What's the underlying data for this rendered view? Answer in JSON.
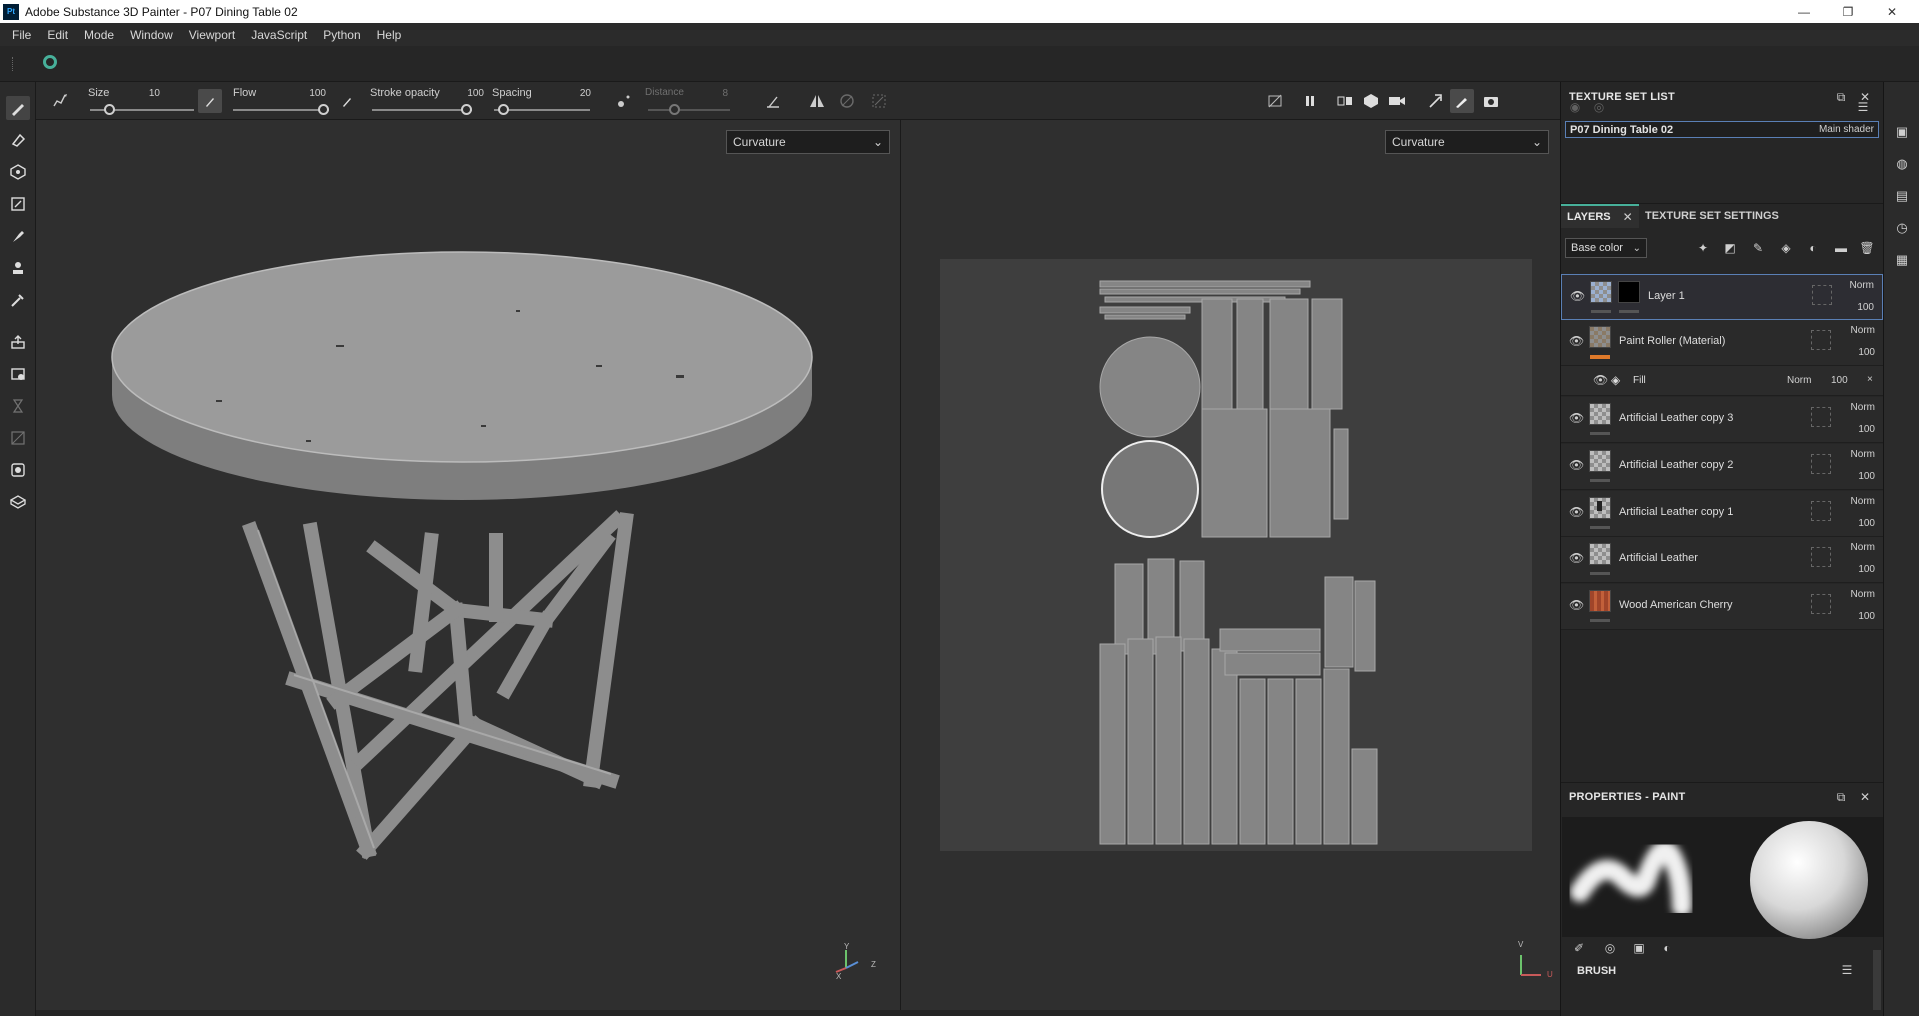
{
  "window": {
    "title": "Adobe Substance 3D Painter - P07 Dining Table 02",
    "app_icon": "Pt",
    "controls": [
      "—",
      "❐",
      "✕"
    ]
  },
  "menu": [
    "File",
    "Edit",
    "Mode",
    "Window",
    "Viewport",
    "JavaScript",
    "Python",
    "Help"
  ],
  "toolbar": {
    "size": {
      "label": "Size",
      "value": "10",
      "fraction": 0.15
    },
    "flow": {
      "label": "Flow",
      "value": "100",
      "fraction": 1.0
    },
    "stroke_opacity": {
      "label": "Stroke opacity",
      "value": "100",
      "fraction": 1.0
    },
    "spacing": {
      "label": "Spacing",
      "value": "20",
      "fraction": 0.05
    },
    "distance": {
      "label": "Distance",
      "value": "8",
      "fraction": 0.3
    }
  },
  "viewport3d": {
    "channel": "Curvature",
    "axis_labels": [
      "Y",
      "Z",
      "X"
    ]
  },
  "viewport2d": {
    "channel": "Curvature",
    "axis_labels": [
      "V",
      "U"
    ]
  },
  "texture_set_list": {
    "title": "TEXTURE SET LIST",
    "item_name": "P07 Dining Table 02",
    "item_shader": "Main shader"
  },
  "layers_panel": {
    "tabs": [
      "LAYERS",
      "TEXTURE SET SETTINGS"
    ],
    "channel": "Base color",
    "layers": [
      {
        "name": "Layer 1",
        "blend": "Norm",
        "opacity": "100"
      },
      {
        "name": "Paint Roller (Material)",
        "blend": "Norm",
        "opacity": "100"
      },
      {
        "name": "Artificial Leather copy 3",
        "blend": "Norm",
        "opacity": "100"
      },
      {
        "name": "Artificial Leather copy 2",
        "blend": "Norm",
        "opacity": "100"
      },
      {
        "name": "Artificial Leather copy 1",
        "blend": "Norm",
        "opacity": "100"
      },
      {
        "name": "Artificial Leather",
        "blend": "Norm",
        "opacity": "100"
      },
      {
        "name": "Wood American Cherry",
        "blend": "Norm",
        "opacity": "100"
      }
    ],
    "fill_effect": {
      "name": "Fill",
      "blend": "Norm",
      "opacity": "100",
      "close": "×"
    }
  },
  "properties": {
    "title": "PROPERTIES - PAINT",
    "brush_section": "BRUSH"
  },
  "colors": {
    "accent": "#47b09a",
    "selected_border": "#5a7fb5",
    "orange": "#e07a2a"
  }
}
